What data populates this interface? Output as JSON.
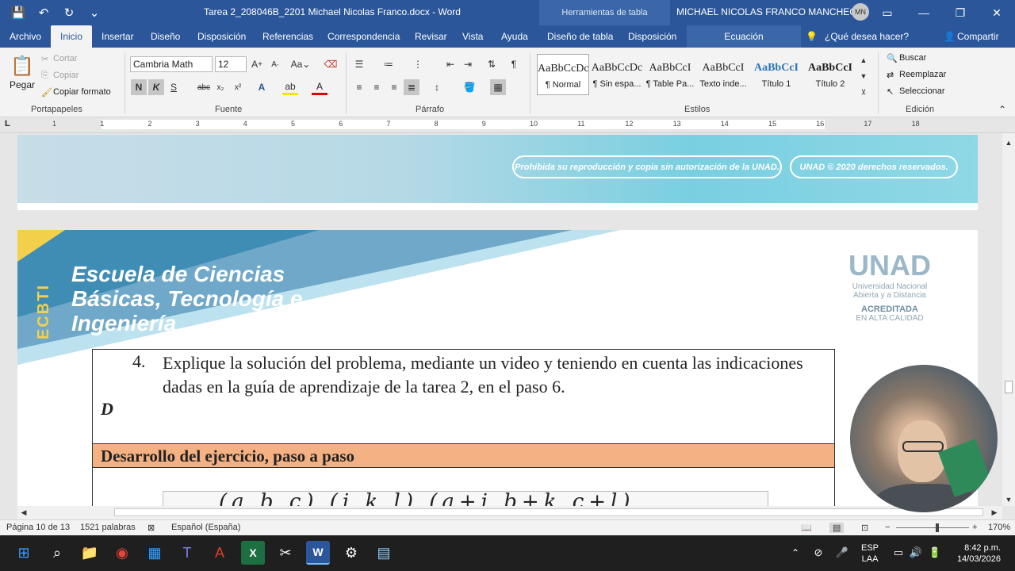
{
  "window": {
    "doc_title": "Tarea 2_208046B_2201 Michael Nicolas Franco.docx  -  Word",
    "context_tools": "Herramientas de tabla",
    "user_name": "MICHAEL NICOLAS FRANCO MANCHEGO",
    "user_initials": "MN"
  },
  "tabs": [
    "Archivo",
    "Inicio",
    "Insertar",
    "Diseño",
    "Disposición",
    "Referencias",
    "Correspondencia",
    "Revisar",
    "Vista",
    "Ayuda",
    "Diseño de tabla",
    "Disposición",
    "Ecuación"
  ],
  "tell_me": "¿Qué desea hacer?",
  "share": "Compartir",
  "ribbon": {
    "clipboard": {
      "paste": "Pegar",
      "cut": "Cortar",
      "copy": "Copiar",
      "format_painter": "Copiar formato",
      "label": "Portapapeles"
    },
    "font": {
      "name": "Cambria Math",
      "size": "12",
      "label": "Fuente",
      "bold": "N",
      "italic": "K",
      "strike": "abc",
      "sub": "x₂",
      "sup": "x²"
    },
    "paragraph": {
      "label": "Párrafo"
    },
    "styles": {
      "label": "Estilos",
      "items": [
        {
          "sample": "AaBbCcDc",
          "name": "¶ Normal"
        },
        {
          "sample": "AaBbCcDc",
          "name": "¶ Sin espa..."
        },
        {
          "sample": "AaBbCcI",
          "name": "¶ Table Pa..."
        },
        {
          "sample": "AaBbCcI",
          "name": "Texto inde..."
        },
        {
          "sample": "AaBbCcI",
          "name": "Título 1"
        },
        {
          "sample": "AaBbCcI",
          "name": "Título 2"
        }
      ]
    },
    "editing": {
      "find": "Buscar",
      "replace": "Reemplazar",
      "select": "Seleccionar",
      "label": "Edición"
    }
  },
  "ruler_numbers": [
    "1",
    "1",
    "2",
    "3",
    "4",
    "5",
    "6",
    "7",
    "8",
    "9",
    "10",
    "11",
    "12",
    "13",
    "14",
    "15",
    "16",
    "17",
    "18"
  ],
  "page1": {
    "notice1": "Prohibida su reproducción y copia sin autorización de la UNAD.",
    "notice2": "UNAD © 2020 derechos reservados."
  },
  "page2": {
    "ecbti": "ECBTI",
    "school": [
      "Escuela de Ciencias",
      "Básicas, Tecnología e",
      "Ingeniería"
    ],
    "unad_logo": "UNAD",
    "unad_line1": "Universidad Nacional",
    "unad_line2": "Abierta y a Distancia",
    "unad_acc": "ACREDITADA",
    "unad_quality": "EN ALTA CALIDAD",
    "question_number": "4.",
    "question_text": "Explique la solución del problema, mediante un video y teniendo en cuenta las indicaciones dadas en la guía de aprendizaje de la tarea 2, en el paso 6.",
    "d_letter": "D",
    "section_title": "Desarrollo del ejercicio, paso a paso",
    "equation_fragment": "(a  b  c)   (i  k  l)   (a+i  b+k  c+l)"
  },
  "status": {
    "page": "Página 10 de 13",
    "words": "1521 palabras",
    "language": "Español (España)",
    "zoom": "170%"
  },
  "tray": {
    "lang": "ESP",
    "layout": "LAA",
    "time": "8:42 p.m.",
    "date": "14/03/2026"
  },
  "colors": {
    "word_blue": "#2b579a",
    "table_header": "#f4b183",
    "taskbar": "#1f1f1f"
  }
}
